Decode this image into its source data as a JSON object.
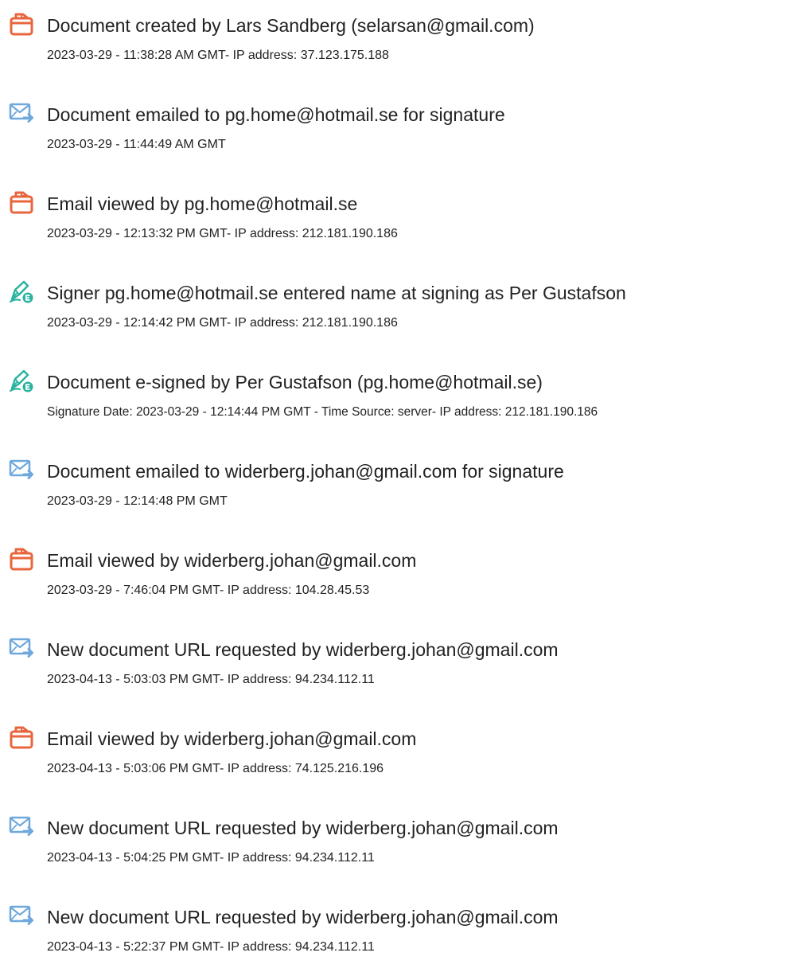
{
  "events": [
    {
      "icon": "document-created-icon",
      "title": "Document created by Lars Sandberg (selarsan@gmail.com)",
      "detail": "2023-03-29 - 11:38:28 AM GMT- IP address: 37.123.175.188"
    },
    {
      "icon": "email-sent-icon",
      "title": "Document emailed to pg.home@hotmail.se for signature",
      "detail": "2023-03-29 - 11:44:49 AM GMT"
    },
    {
      "icon": "document-viewed-icon",
      "title": "Email viewed by pg.home@hotmail.se",
      "detail": "2023-03-29 - 12:13:32 PM GMT- IP address: 212.181.190.186"
    },
    {
      "icon": "signer-pen-icon",
      "title": "Signer pg.home@hotmail.se entered name at signing as Per Gustafson",
      "detail": "2023-03-29 - 12:14:42 PM GMT- IP address: 212.181.190.186"
    },
    {
      "icon": "e-signed-pen-icon",
      "title": "Document e-signed by Per Gustafson (pg.home@hotmail.se)",
      "detail": "Signature Date: 2023-03-29 - 12:14:44 PM GMT - Time Source: server- IP address: 212.181.190.186"
    },
    {
      "icon": "email-sent-icon",
      "title": "Document emailed to widerberg.johan@gmail.com for signature",
      "detail": "2023-03-29 - 12:14:48 PM GMT"
    },
    {
      "icon": "document-viewed-icon",
      "title": "Email viewed by widerberg.johan@gmail.com",
      "detail": "2023-03-29 - 7:46:04 PM GMT- IP address: 104.28.45.53"
    },
    {
      "icon": "email-sent-icon",
      "title": "New document URL requested by widerberg.johan@gmail.com",
      "detail": "2023-04-13 - 5:03:03 PM GMT- IP address: 94.234.112.11"
    },
    {
      "icon": "document-viewed-icon",
      "title": "Email viewed by widerberg.johan@gmail.com",
      "detail": "2023-04-13 - 5:03:06 PM GMT- IP address: 74.125.216.196"
    },
    {
      "icon": "email-sent-icon",
      "title": "New document URL requested by widerberg.johan@gmail.com",
      "detail": "2023-04-13 - 5:04:25 PM GMT- IP address: 94.234.112.11"
    },
    {
      "icon": "email-sent-icon",
      "title": "New document URL requested by widerberg.johan@gmail.com",
      "detail": "2023-04-13 - 5:22:37 PM GMT- IP address: 94.234.112.11"
    }
  ],
  "colors": {
    "document_icon": "#e8663d",
    "email_icon": "#6fa8dc",
    "pen_icon": "#2bb3a0",
    "text": "#222222"
  }
}
